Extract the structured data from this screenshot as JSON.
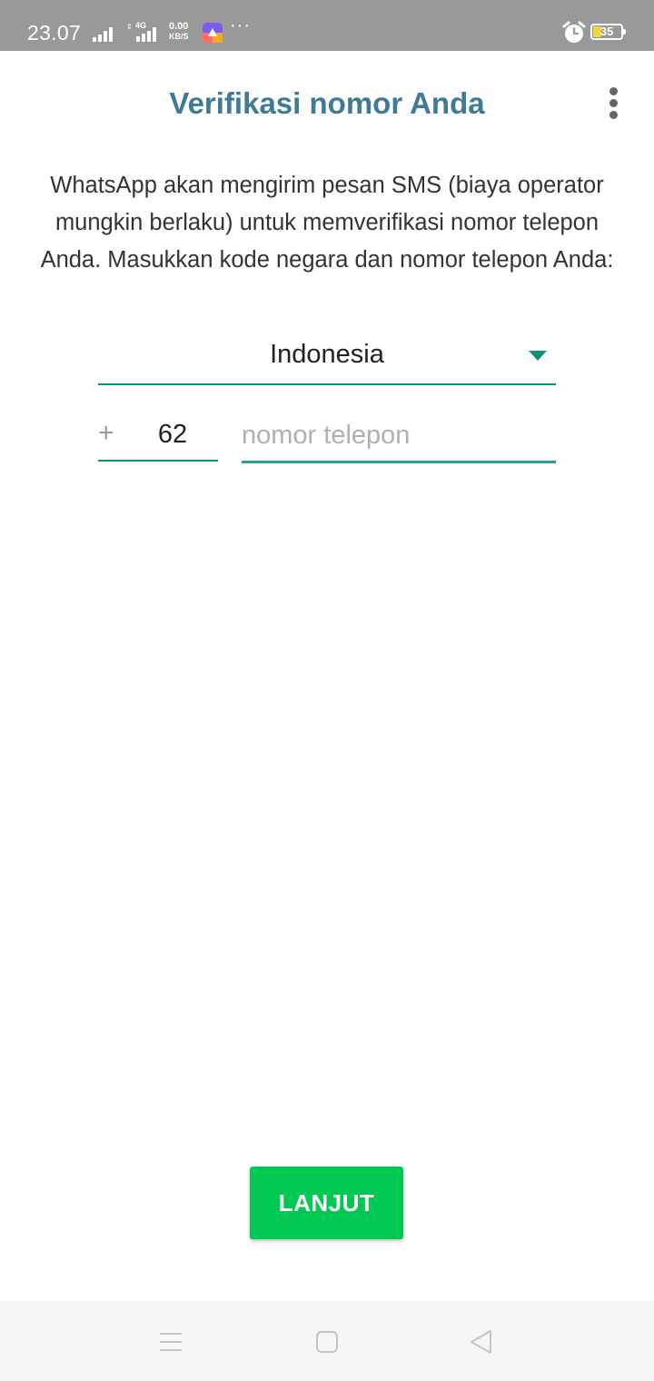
{
  "status_bar": {
    "time": "23.07",
    "network_type": "4G",
    "speed_value": "0.00",
    "speed_unit": "KB/S",
    "more_indicator": "···",
    "battery_level": "35"
  },
  "header": {
    "title": "Verifikasi nomor Anda",
    "menu_icon": "more-vert-icon"
  },
  "content": {
    "description": "WhatsApp akan mengirim pesan SMS (biaya operator mungkin berlaku) untuk memverifikasi nomor telepon Anda. Masukkan kode negara dan nomor telepon Anda:",
    "country": "Indonesia",
    "country_code_prefix": "+",
    "country_code": "62",
    "phone_placeholder": "nomor telepon",
    "phone_value": ""
  },
  "actions": {
    "next_label": "LANJUT"
  },
  "navigation": {
    "menu_icon": "menu-icon",
    "home_icon": "home-icon",
    "back_icon": "back-icon"
  },
  "colors": {
    "title": "#3d7b96",
    "accent": "#128c7e",
    "button": "#00c853",
    "status_bar": "#999999"
  }
}
